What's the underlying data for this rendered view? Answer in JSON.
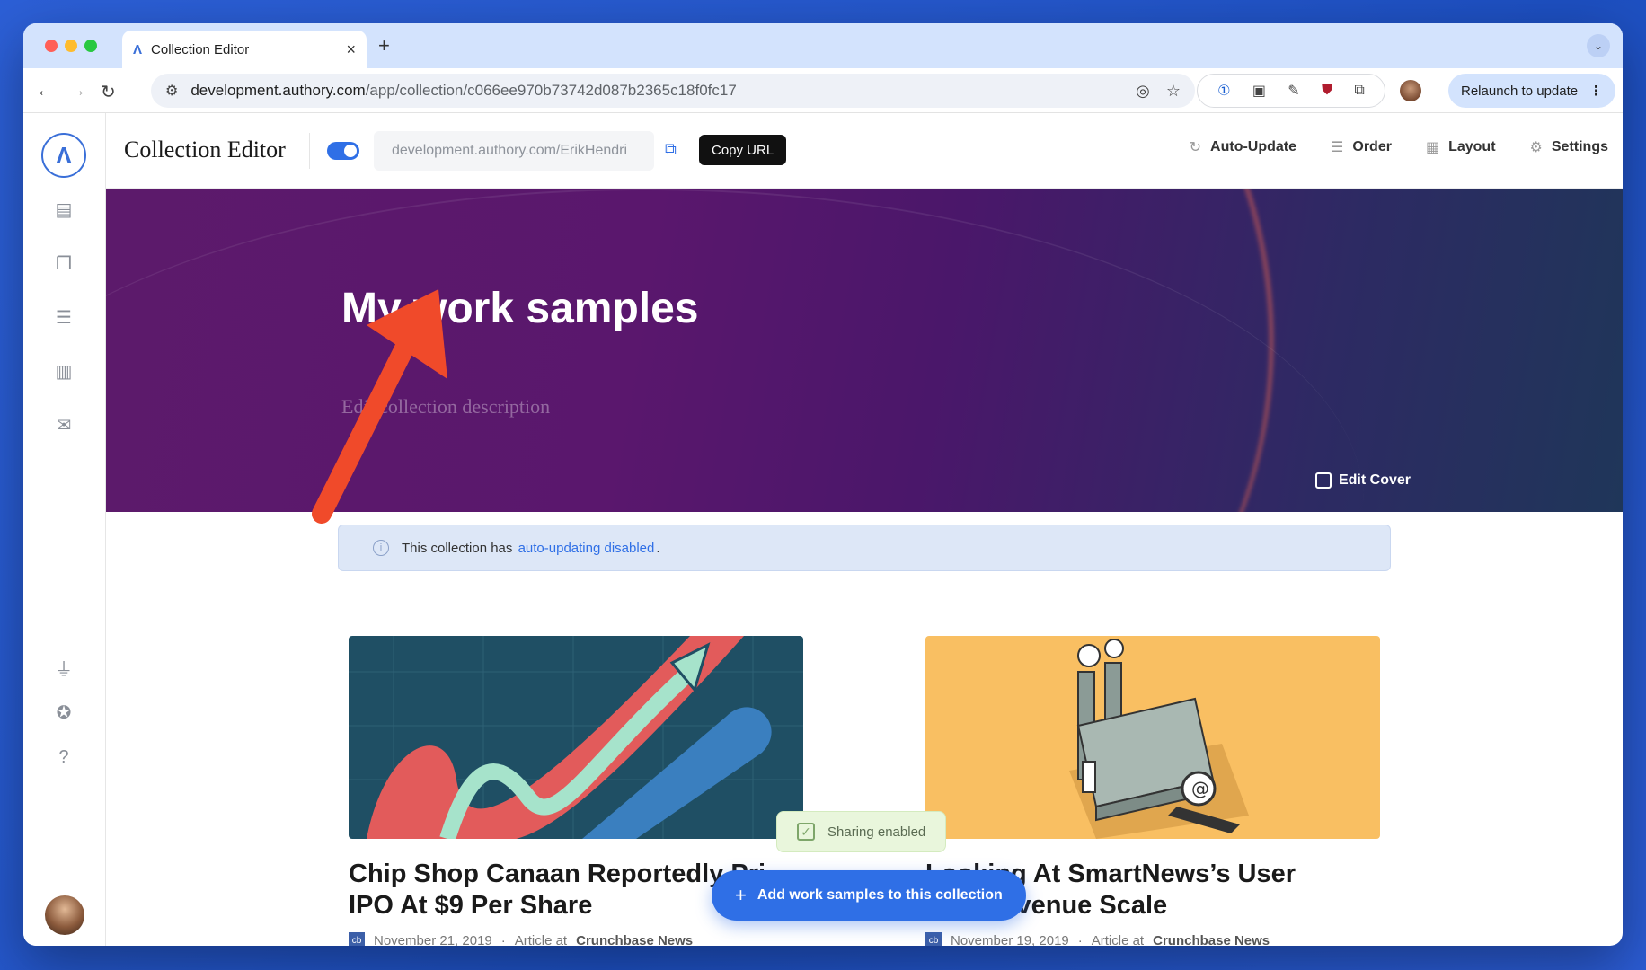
{
  "browser": {
    "tab_title": "Collection Editor",
    "new_tab": "+",
    "tab_close": "×",
    "url_host": "development.authory.com",
    "url_path": "/app/collection/c066ee970b73742d087b2365c18f0fc17",
    "relaunch_label": "Relaunch to update"
  },
  "editor": {
    "title": "Collection Editor",
    "share_url": "development.authory.com/ErikHendri",
    "copy_tooltip": "Copy URL",
    "actions": [
      {
        "label": "Auto-Update",
        "icon": "refresh-icon"
      },
      {
        "label": "Order",
        "icon": "list-icon"
      },
      {
        "label": "Layout",
        "icon": "grid-icon"
      },
      {
        "label": "Settings",
        "icon": "gear-icon"
      }
    ]
  },
  "hero": {
    "title": "My work samples",
    "description_placeholder": "Edit collection description",
    "edit_cover_label": "Edit Cover"
  },
  "infobar": {
    "text_before": "This collection has",
    "link_text": "auto-updating disabled",
    "text_after": "."
  },
  "cards": [
    {
      "headline_line1": "Chip Shop Canaan Reportedly Pri",
      "headline_line2": "IPO At $9 Per Share",
      "date": "November 21, 2019",
      "type": "Article at",
      "source": "Crunchbase News",
      "source_badge": "cb"
    },
    {
      "headline_line1": "Looking At SmartNews’s User",
      "headline_line2": "And Revenue Scale",
      "date": "November 19, 2019",
      "type": "Article at",
      "source": "Crunchbase News",
      "source_badge": "cb"
    }
  ],
  "toast": {
    "text": "Sharing enabled"
  },
  "add_button": {
    "label": "Add work samples to this collection"
  },
  "colors": {
    "accent": "#2f6fe6",
    "arrow": "#f04a2a",
    "hero_start": "#5c1a6b",
    "hero_end": "#1f3659"
  }
}
